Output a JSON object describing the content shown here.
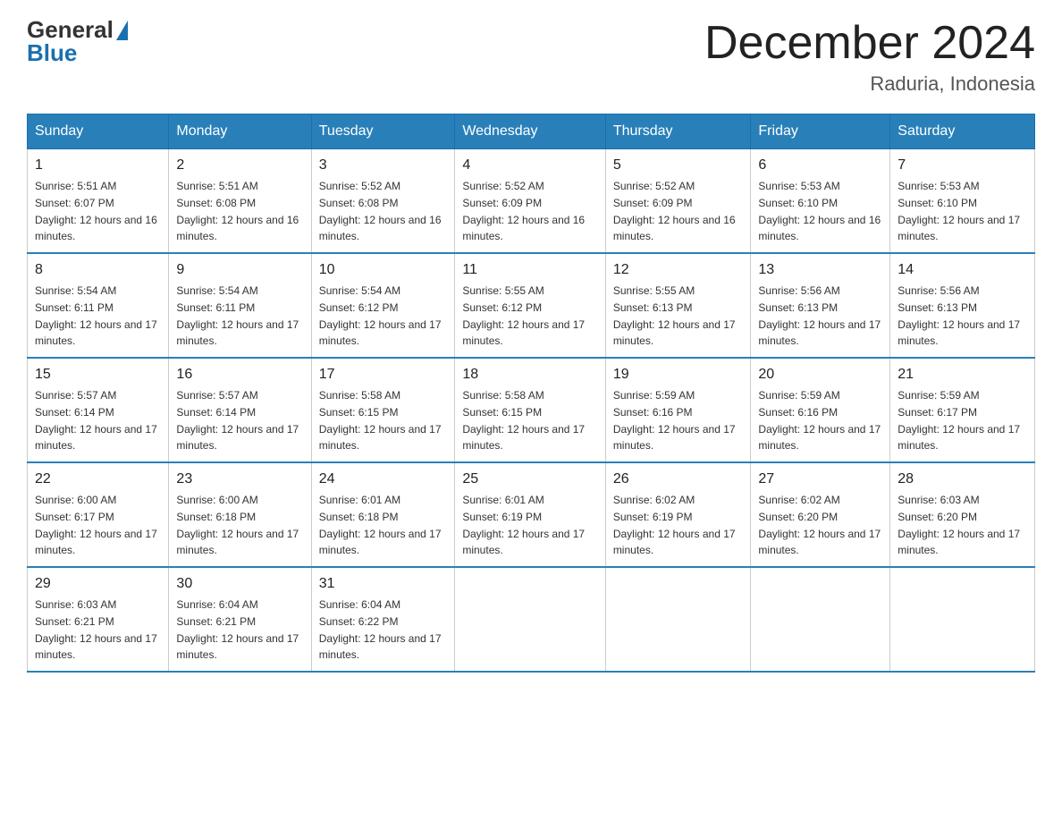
{
  "header": {
    "logo_general": "General",
    "logo_blue": "Blue",
    "month_title": "December 2024",
    "location": "Raduria, Indonesia"
  },
  "weekdays": [
    "Sunday",
    "Monday",
    "Tuesday",
    "Wednesday",
    "Thursday",
    "Friday",
    "Saturday"
  ],
  "weeks": [
    [
      {
        "day": "1",
        "sunrise": "5:51 AM",
        "sunset": "6:07 PM",
        "daylight": "12 hours and 16 minutes."
      },
      {
        "day": "2",
        "sunrise": "5:51 AM",
        "sunset": "6:08 PM",
        "daylight": "12 hours and 16 minutes."
      },
      {
        "day": "3",
        "sunrise": "5:52 AM",
        "sunset": "6:08 PM",
        "daylight": "12 hours and 16 minutes."
      },
      {
        "day": "4",
        "sunrise": "5:52 AM",
        "sunset": "6:09 PM",
        "daylight": "12 hours and 16 minutes."
      },
      {
        "day": "5",
        "sunrise": "5:52 AM",
        "sunset": "6:09 PM",
        "daylight": "12 hours and 16 minutes."
      },
      {
        "day": "6",
        "sunrise": "5:53 AM",
        "sunset": "6:10 PM",
        "daylight": "12 hours and 16 minutes."
      },
      {
        "day": "7",
        "sunrise": "5:53 AM",
        "sunset": "6:10 PM",
        "daylight": "12 hours and 17 minutes."
      }
    ],
    [
      {
        "day": "8",
        "sunrise": "5:54 AM",
        "sunset": "6:11 PM",
        "daylight": "12 hours and 17 minutes."
      },
      {
        "day": "9",
        "sunrise": "5:54 AM",
        "sunset": "6:11 PM",
        "daylight": "12 hours and 17 minutes."
      },
      {
        "day": "10",
        "sunrise": "5:54 AM",
        "sunset": "6:12 PM",
        "daylight": "12 hours and 17 minutes."
      },
      {
        "day": "11",
        "sunrise": "5:55 AM",
        "sunset": "6:12 PM",
        "daylight": "12 hours and 17 minutes."
      },
      {
        "day": "12",
        "sunrise": "5:55 AM",
        "sunset": "6:13 PM",
        "daylight": "12 hours and 17 minutes."
      },
      {
        "day": "13",
        "sunrise": "5:56 AM",
        "sunset": "6:13 PM",
        "daylight": "12 hours and 17 minutes."
      },
      {
        "day": "14",
        "sunrise": "5:56 AM",
        "sunset": "6:13 PM",
        "daylight": "12 hours and 17 minutes."
      }
    ],
    [
      {
        "day": "15",
        "sunrise": "5:57 AM",
        "sunset": "6:14 PM",
        "daylight": "12 hours and 17 minutes."
      },
      {
        "day": "16",
        "sunrise": "5:57 AM",
        "sunset": "6:14 PM",
        "daylight": "12 hours and 17 minutes."
      },
      {
        "day": "17",
        "sunrise": "5:58 AM",
        "sunset": "6:15 PM",
        "daylight": "12 hours and 17 minutes."
      },
      {
        "day": "18",
        "sunrise": "5:58 AM",
        "sunset": "6:15 PM",
        "daylight": "12 hours and 17 minutes."
      },
      {
        "day": "19",
        "sunrise": "5:59 AM",
        "sunset": "6:16 PM",
        "daylight": "12 hours and 17 minutes."
      },
      {
        "day": "20",
        "sunrise": "5:59 AM",
        "sunset": "6:16 PM",
        "daylight": "12 hours and 17 minutes."
      },
      {
        "day": "21",
        "sunrise": "5:59 AM",
        "sunset": "6:17 PM",
        "daylight": "12 hours and 17 minutes."
      }
    ],
    [
      {
        "day": "22",
        "sunrise": "6:00 AM",
        "sunset": "6:17 PM",
        "daylight": "12 hours and 17 minutes."
      },
      {
        "day": "23",
        "sunrise": "6:00 AM",
        "sunset": "6:18 PM",
        "daylight": "12 hours and 17 minutes."
      },
      {
        "day": "24",
        "sunrise": "6:01 AM",
        "sunset": "6:18 PM",
        "daylight": "12 hours and 17 minutes."
      },
      {
        "day": "25",
        "sunrise": "6:01 AM",
        "sunset": "6:19 PM",
        "daylight": "12 hours and 17 minutes."
      },
      {
        "day": "26",
        "sunrise": "6:02 AM",
        "sunset": "6:19 PM",
        "daylight": "12 hours and 17 minutes."
      },
      {
        "day": "27",
        "sunrise": "6:02 AM",
        "sunset": "6:20 PM",
        "daylight": "12 hours and 17 minutes."
      },
      {
        "day": "28",
        "sunrise": "6:03 AM",
        "sunset": "6:20 PM",
        "daylight": "12 hours and 17 minutes."
      }
    ],
    [
      {
        "day": "29",
        "sunrise": "6:03 AM",
        "sunset": "6:21 PM",
        "daylight": "12 hours and 17 minutes."
      },
      {
        "day": "30",
        "sunrise": "6:04 AM",
        "sunset": "6:21 PM",
        "daylight": "12 hours and 17 minutes."
      },
      {
        "day": "31",
        "sunrise": "6:04 AM",
        "sunset": "6:22 PM",
        "daylight": "12 hours and 17 minutes."
      },
      null,
      null,
      null,
      null
    ]
  ]
}
